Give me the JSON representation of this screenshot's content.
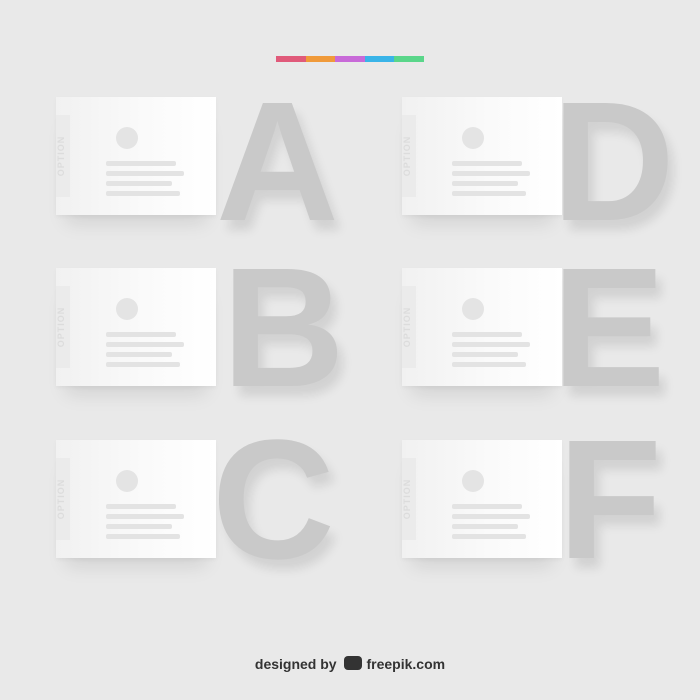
{
  "colors": {
    "background": "#e9e9e9",
    "accent_bar": [
      "#e05a7a",
      "#f09a3a",
      "#c86ad8",
      "#3ab4e8",
      "#5ad68a"
    ],
    "letter": "#c9c9c9"
  },
  "cards": [
    {
      "letter": "A",
      "option_label": "OPTION",
      "icon": "globe-icon"
    },
    {
      "letter": "B",
      "option_label": "OPTION",
      "icon": "clock-icon"
    },
    {
      "letter": "C",
      "option_label": "OPTION",
      "icon": "chart-icon"
    },
    {
      "letter": "D",
      "option_label": "OPTION",
      "icon": "pin-icon"
    },
    {
      "letter": "E",
      "option_label": "OPTION",
      "icon": "gear-icon"
    },
    {
      "letter": "F",
      "option_label": "OPTION",
      "icon": "rocket-icon"
    }
  ],
  "credit": {
    "prefix": "designed by",
    "brand": "freepik.com",
    "logo_icon": "freepik-owl-icon"
  }
}
